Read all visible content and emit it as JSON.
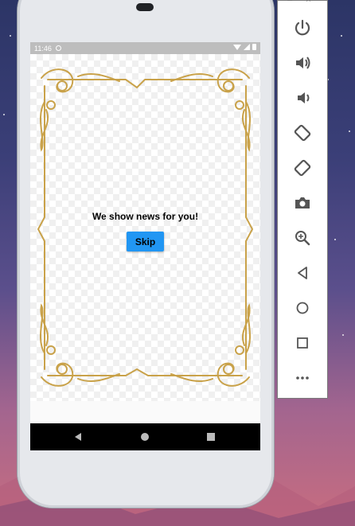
{
  "status_bar": {
    "time": "11:46"
  },
  "app": {
    "headline": "We show news for you!",
    "skip_label": "Skip"
  },
  "emulator_panel": {
    "window_controls": [
      "–",
      "×"
    ],
    "buttons": [
      "power-icon",
      "volume-up-icon",
      "volume-down-icon",
      "rotate-left-icon",
      "rotate-right-icon",
      "camera-icon",
      "zoom-icon",
      "back-icon",
      "home-icon",
      "overview-icon",
      "more-icon"
    ]
  },
  "colors": {
    "skip_button": "#2196f3",
    "frame_gold": "#c9a24a",
    "status_bar": "#bdbdbd",
    "nav_bar": "#000000"
  }
}
